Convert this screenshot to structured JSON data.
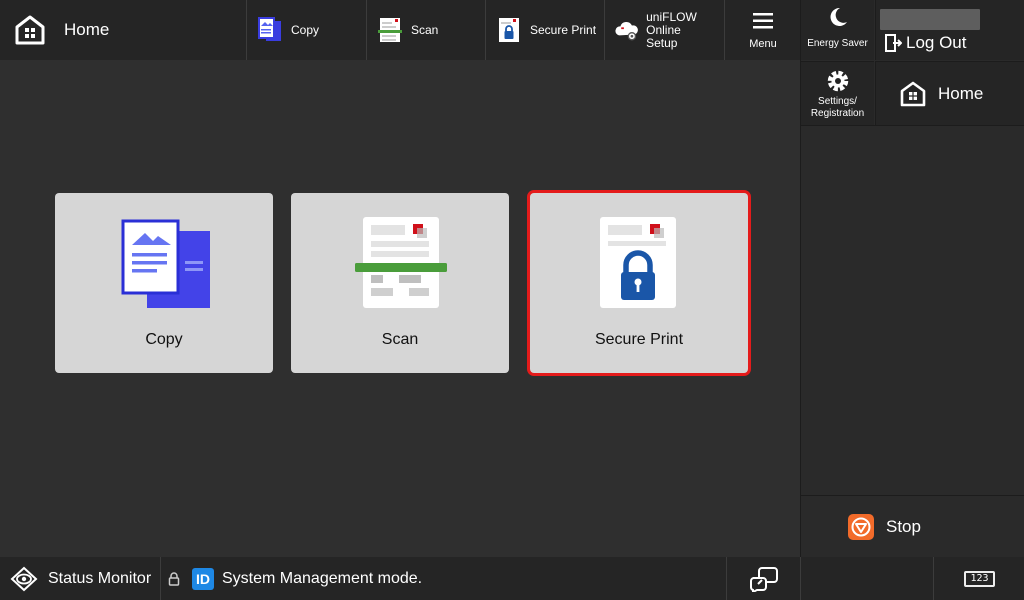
{
  "topbar": {
    "home_label": "Home",
    "copy_label": "Copy",
    "scan_label": "Scan",
    "secure_print_label": "Secure Print",
    "uniflow_label_line1": "uniFLOW Online",
    "uniflow_label_line2": "Setup",
    "menu_label": "Menu"
  },
  "right_panel": {
    "energy_saver_label": "Energy Saver",
    "logout_label": "Log Out",
    "settings_line1": "Settings/",
    "settings_line2": "Registration",
    "home_label": "Home",
    "stop_label": "Stop"
  },
  "tiles": [
    {
      "label": "Copy"
    },
    {
      "label": "Scan"
    },
    {
      "label": "Secure Print",
      "selected": true
    }
  ],
  "bottombar": {
    "status_monitor_label": "Status Monitor",
    "system_message": "System Management mode.",
    "id_badge": "ID",
    "keyboard_label": "123"
  },
  "colors": {
    "background": "#2f2f2f",
    "bar": "#252525",
    "tile": "#d6d6d6",
    "selection": "#e41b1b",
    "stop": "#f26b2a",
    "id_badge": "#1e88e5",
    "lock_blue": "#1a56a8"
  }
}
